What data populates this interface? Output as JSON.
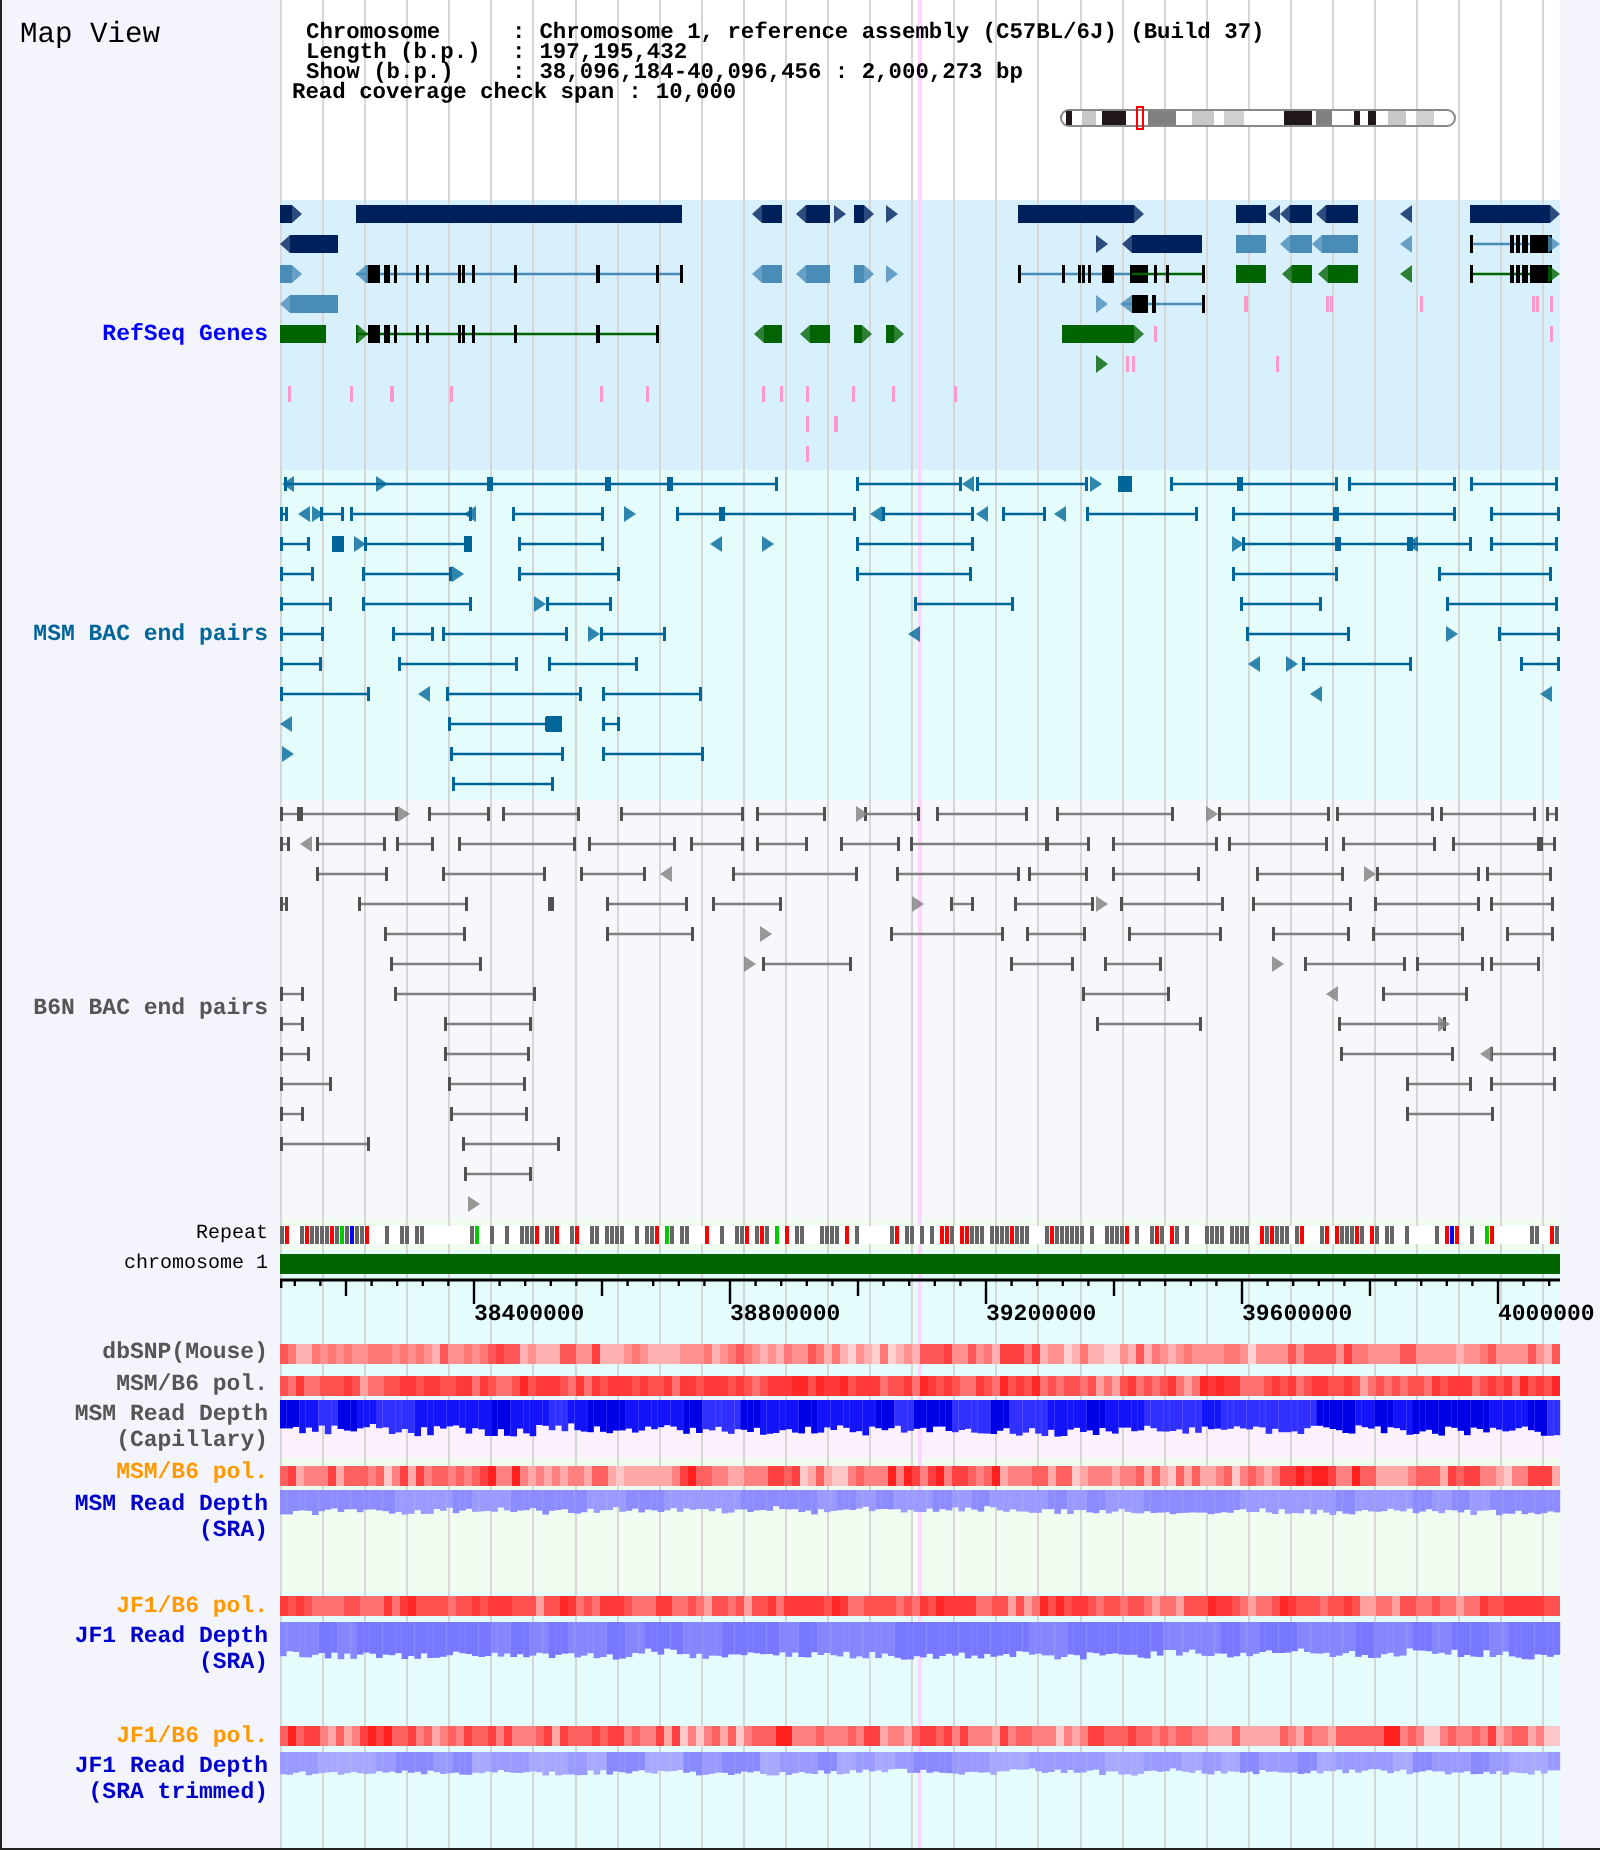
{
  "title": "Map View",
  "info": {
    "separator": ":",
    "lines": [
      {
        "label": "Chromosome",
        "value": "Chromosome 1, reference assembly (C57BL/6J) (Build 37)"
      },
      {
        "label": "Length (b.p.)",
        "value": "197,195,432"
      },
      {
        "label": "Show (b.p.)",
        "value": "38,096,184-40,096,456 : 2,000,273 bp"
      }
    ],
    "coverage": {
      "label": "Read coverage check span",
      "value": "10,000"
    }
  },
  "tracks": [
    {
      "kind": "genes",
      "label": "RefSeq Genes",
      "color": "#0000ff"
    },
    {
      "kind": "bac_pairs",
      "label": "MSM BAC end pairs",
      "color": "#006699"
    },
    {
      "kind": "bac_pairs",
      "label": "B6N BAC end pairs",
      "color": "#555555"
    },
    {
      "kind": "repeat",
      "label": "Repeat",
      "color": "#000000"
    },
    {
      "kind": "chromosome",
      "label": "chromosome 1",
      "color": "#000000"
    },
    {
      "kind": "ruler",
      "ticks": [
        "38400000",
        "38800000",
        "39200000",
        "39600000",
        "4000000"
      ]
    },
    {
      "kind": "heatmap",
      "label": "dbSNP(Mouse)",
      "color": "#555555"
    },
    {
      "kind": "heatmap",
      "label": "MSM/B6 pol.",
      "color": "#555555"
    },
    {
      "kind": "depth",
      "label": "MSM Read Depth (Capillary)",
      "color": "#555555"
    },
    {
      "kind": "heatmap",
      "label": "MSM/B6 pol.",
      "color": "#ff9900"
    },
    {
      "kind": "depth",
      "label": "MSM Read Depth (SRA)",
      "color": "#0000cc"
    },
    {
      "kind": "heatmap",
      "label": "JF1/B6 pol.",
      "color": "#ff9900"
    },
    {
      "kind": "depth",
      "label": "JF1 Read Depth (SRA)",
      "color": "#0000cc"
    },
    {
      "kind": "heatmap",
      "label": "JF1/B6 pol.",
      "color": "#ff9900"
    },
    {
      "kind": "depth",
      "label": "JF1 Read Depth (SRA trimmed)",
      "color": "#0000cc"
    }
  ]
}
